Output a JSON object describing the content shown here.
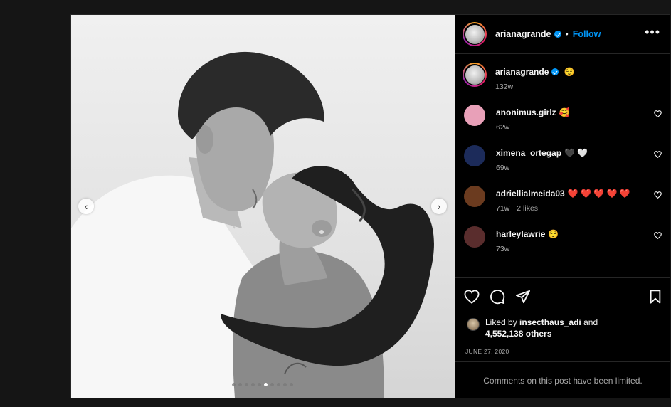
{
  "post": {
    "author": "arianagrande",
    "follow_label": "Follow",
    "separator": "•",
    "more_label": "•••",
    "caption_emoji": "😌",
    "caption_age": "132w",
    "carousel": {
      "prev": "‹",
      "next": "›",
      "slide_count": 10,
      "active_index": 5
    }
  },
  "comments": [
    {
      "user": "anonimus.girlz",
      "text": "🥰",
      "age": "62w",
      "likes": "",
      "avatar_color": "#e8a0b8"
    },
    {
      "user": "ximena_ortegap",
      "text": "🖤 🤍",
      "age": "69w",
      "likes": "",
      "avatar_color": "#1c2b5a"
    },
    {
      "user": "adriellialmeida03",
      "text": "❤️ ❤️ ❤️ ❤️ ❤️",
      "age": "71w",
      "likes": "2 likes",
      "avatar_color": "#6b3b1f"
    },
    {
      "user": "harleylawrie",
      "text": "😌",
      "age": "73w",
      "likes": "",
      "avatar_color": "#5a2d2d"
    }
  ],
  "likes": {
    "prefix": "Liked by",
    "user": "insecthaus_adi",
    "and": "and",
    "count": "4,552,138 others"
  },
  "date": "JUNE 27, 2020",
  "comments_limited": "Comments on this post have been limited."
}
